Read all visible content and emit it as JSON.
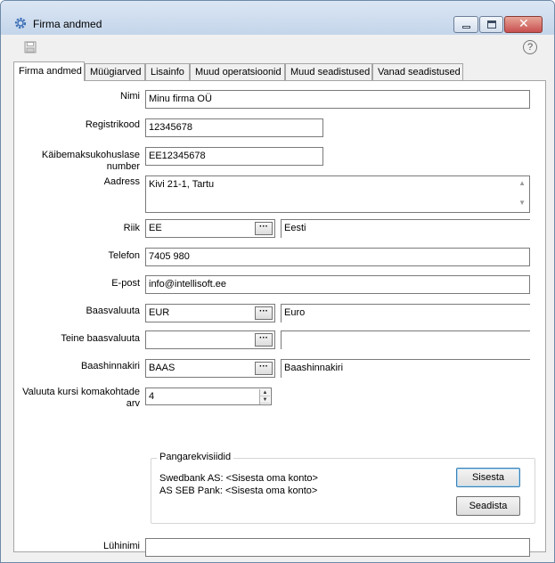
{
  "window": {
    "title": "Firma andmed",
    "close_glyph": "✕"
  },
  "toolbar": {
    "help_glyph": "?"
  },
  "tabs": [
    {
      "label": "Firma andmed",
      "active": true
    },
    {
      "label": "Müügiarved"
    },
    {
      "label": "Lisainfo"
    },
    {
      "label": "Muud operatsioonid"
    },
    {
      "label": "Muud seadistused"
    },
    {
      "label": "Vanad seadistused"
    }
  ],
  "form": {
    "name": {
      "label": "Nimi",
      "value": "Minu firma OÜ"
    },
    "regcode": {
      "label": "Registrikood",
      "value": "12345678"
    },
    "vat": {
      "label": "Käibemaksukohuslase number",
      "value": "EE12345678"
    },
    "address": {
      "label": "Aadress",
      "value": "Kivi 21-1, Tartu"
    },
    "country": {
      "label": "Riik",
      "code": "EE",
      "name": "Eesti"
    },
    "phone": {
      "label": "Telefon",
      "value": "7405 980"
    },
    "email": {
      "label": "E-post",
      "value": "info@intellisoft.ee"
    },
    "base_currency": {
      "label": "Baasvaluuta",
      "code": "EUR",
      "name": "Euro"
    },
    "second_currency": {
      "label": "Teine baasvaluuta",
      "code": "",
      "name": ""
    },
    "base_pricelist": {
      "label": "Baashinnakiri",
      "code": "BAAS",
      "name": "Baashinnakiri"
    },
    "decimals": {
      "label": "Valuuta kursi komakohtade arv",
      "value": "4"
    },
    "short_name": {
      "label": "Lühinimi",
      "value": ""
    },
    "dots": "···"
  },
  "bank": {
    "title": "Pangarekvisiidid",
    "lines": [
      "Swedbank AS: <Sisesta oma konto>",
      "AS SEB Pank: <Sisesta oma konto>"
    ],
    "enter_button": "Sisesta",
    "setup_button": "Seadista"
  }
}
